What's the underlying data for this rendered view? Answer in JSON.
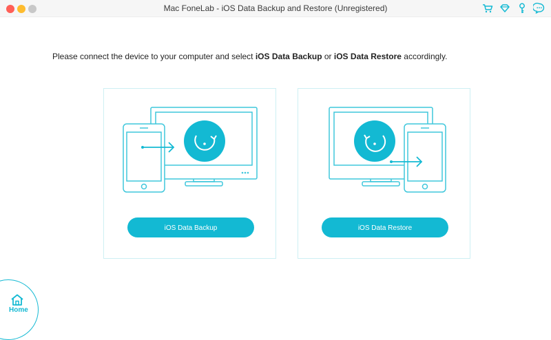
{
  "window": {
    "title": "Mac FoneLab - iOS Data Backup and Restore (Unregistered)"
  },
  "toolbar_icons": [
    "cart-icon",
    "diamond-icon",
    "key-icon",
    "chat-icon"
  ],
  "instruction": {
    "prefix": "Please connect the device to your computer and select ",
    "option1": "iOS Data Backup",
    "middle": " or ",
    "option2": "iOS Data Restore",
    "suffix": " accordingly."
  },
  "cards": {
    "backup": {
      "button_label": "iOS Data Backup"
    },
    "restore": {
      "button_label": "iOS Data Restore"
    }
  },
  "home": {
    "label": "Home"
  },
  "colors": {
    "accent": "#13b9d3",
    "card_border": "#cdeff3"
  }
}
